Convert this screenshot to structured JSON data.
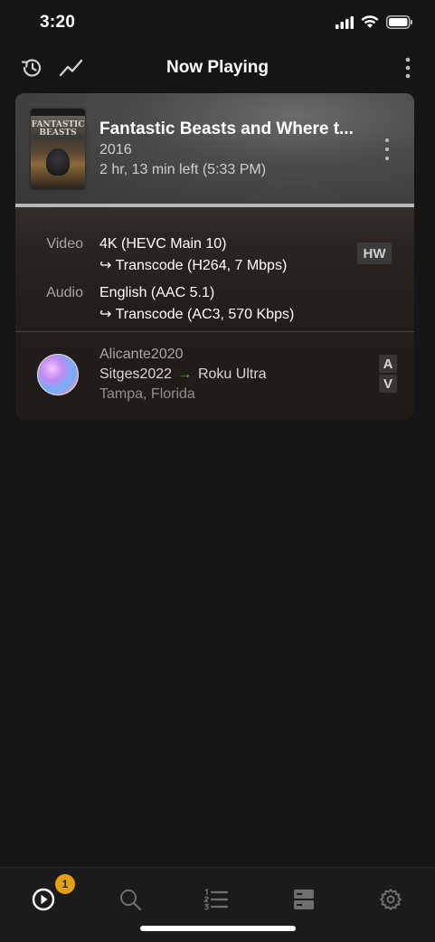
{
  "status": {
    "time": "3:20"
  },
  "header": {
    "title": "Now Playing",
    "history_icon": "history-icon",
    "stats_icon": "trend-icon",
    "more_icon": "more-vertical-icon"
  },
  "session": {
    "poster_text": "FANTASTIC BEASTS",
    "title": "Fantastic Beasts and Where t...",
    "year": "2016",
    "time_left": "2 hr, 13 min left (5:33 PM)",
    "progress_fraction": 1.0,
    "video_label": "Video",
    "video_source": "4K (HEVC Main 10)",
    "video_transcode": "↪ Transcode (H264, 7 Mbps)",
    "hw_badge": "HW",
    "audio_label": "Audio",
    "audio_source": "English (AAC 5.1)",
    "audio_transcode": "↪ Transcode (AC3, 570 Kbps)",
    "user": "Alicante2020",
    "server": "Sitges2022",
    "arrow": "→",
    "player": "Roku Ultra",
    "location": "Tampa, Florida",
    "badge_a": "A",
    "badge_v": "V"
  },
  "tabbar": {
    "items": [
      "now-playing",
      "search",
      "list",
      "servers",
      "settings"
    ],
    "now_playing_count": "1"
  },
  "colors": {
    "accent": "#e5a00d",
    "arrow": "#4caf50"
  }
}
